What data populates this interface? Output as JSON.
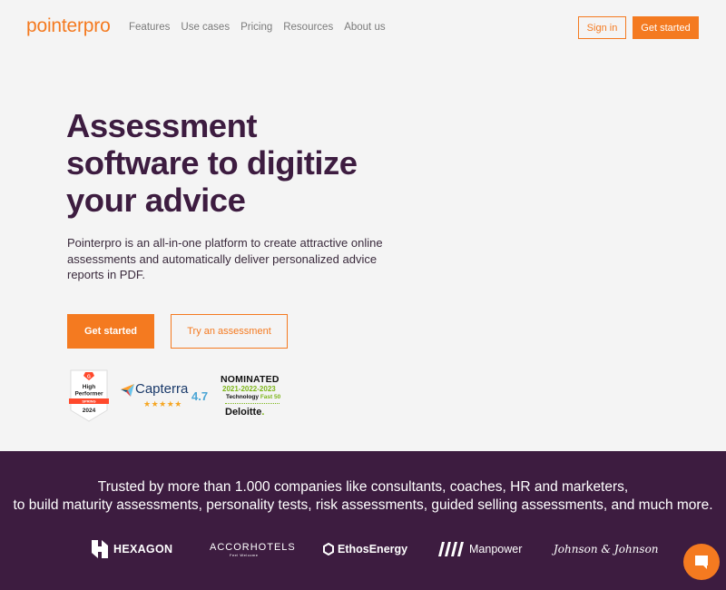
{
  "header": {
    "logo": "pointerpro",
    "nav": [
      "Features",
      "Use cases",
      "Pricing",
      "Resources",
      "About us"
    ],
    "signin_label": "Sign in",
    "getstarted_label": "Get started"
  },
  "hero": {
    "title_lines": [
      "Assessment",
      "software to digitize",
      "your advice"
    ],
    "description": "Pointerpro is an all-in-one platform to create attractive online assessments and automatically deliver personalized advice reports in PDF.",
    "primary_cta": "Get started",
    "secondary_cta": "Try an assessment"
  },
  "badges": {
    "g2": {
      "line1": "High",
      "line2": "Performer",
      "ribbon": "SPRING",
      "year": "2024"
    },
    "capterra": {
      "name": "Capterra",
      "score": "4.7",
      "stars": "★★★★★"
    },
    "deloitte": {
      "nominated": "NOMINATED",
      "years": "2021-2022-2023",
      "tech": "Technology",
      "fast50": "Fast 50",
      "name": "Deloitte",
      "dot": "."
    }
  },
  "trust": {
    "line1": "Trusted by more than 1.000 companies like consultants, coaches, HR and marketers,",
    "line2": "to build maturity assessments, personality tests, risk assessments, guided selling assessments, and much more."
  },
  "client_logos": {
    "hexagon": "HEXAGON",
    "accor": "ACCORHOTELS",
    "accor_tag": "Feel Welcome",
    "ethos": "EthosEnergy",
    "manpower": "Manpower",
    "jj": "Johnson & Johnson"
  },
  "colors": {
    "accent": "#f47a20",
    "brand_dark": "#3d1c40",
    "background": "#f4f4f4"
  },
  "icons": {
    "chat": "chat-icon"
  }
}
